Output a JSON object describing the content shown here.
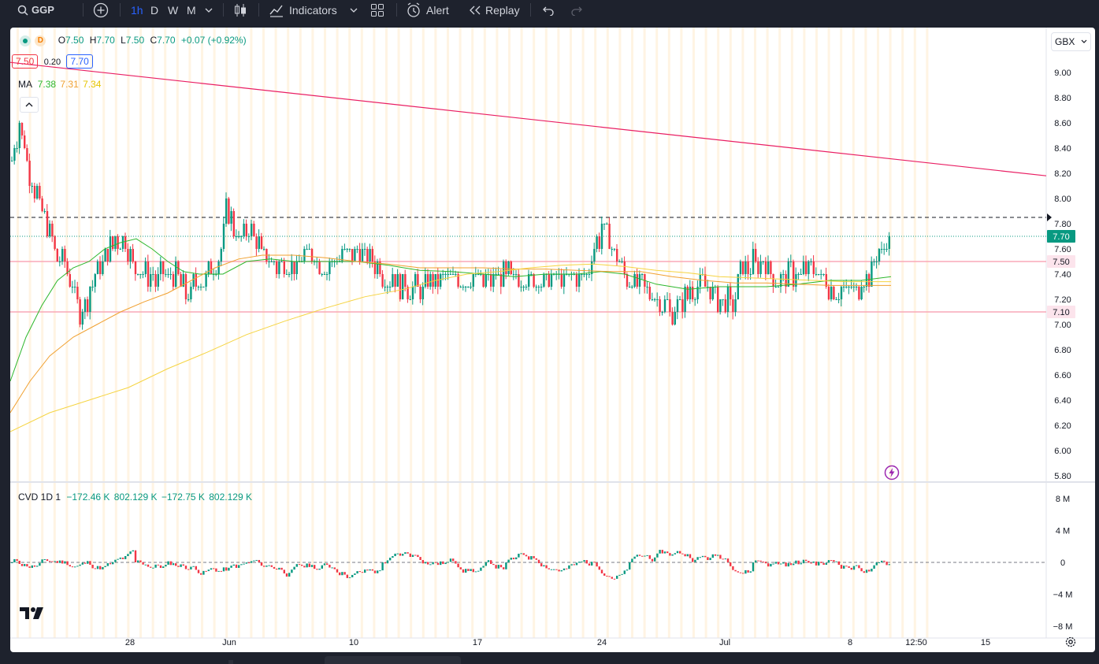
{
  "toolbar": {
    "symbol": "GGP",
    "intervals": [
      "1h",
      "D",
      "W",
      "M"
    ],
    "indicators_label": "Indicators",
    "alert_label": "Alert",
    "replay_label": "Replay"
  },
  "legend": {
    "open_label": "O",
    "open": "7.50",
    "high_label": "H",
    "high": "7.70",
    "low_label": "L",
    "low": "7.50",
    "close_label": "C",
    "close": "7.70",
    "change": "+0.07 (+0.92%)",
    "bid": "7.50",
    "spread": "0.20",
    "ask": "7.70",
    "ma_label": "MA",
    "ma_values": [
      "7.38",
      "7.31",
      "7.34"
    ],
    "cvd_label": "CVD 1D 1",
    "cvd_values": [
      "−172.46 K",
      "802.129 K",
      "−172.75 K",
      "802.129 K"
    ],
    "currency": "GBX"
  },
  "price_scale": [
    "9.00",
    "8.80",
    "8.60",
    "8.40",
    "8.20",
    "8.00",
    "7.80",
    "7.60",
    "7.40",
    "7.20",
    "7.00",
    "6.80",
    "6.60",
    "6.40",
    "6.20",
    "6.00",
    "5.80"
  ],
  "price_badges": {
    "last": "7.70",
    "upper_line": "7.50",
    "lower_line": "7.10"
  },
  "cvd_scale": [
    "8 M",
    "4 M",
    "0",
    "−4 M",
    "−8 M"
  ],
  "time_labels": [
    "28",
    "Jun",
    "10",
    "17",
    "24",
    "Jul",
    "8",
    "12:50",
    "15"
  ],
  "colors": {
    "up": "#089981",
    "down": "#f23645",
    "ma_fast": "#2db72d",
    "ma_mid": "#f0a030",
    "ma_slow": "#f5d442",
    "trendline": "#e91e63",
    "hline": "#f8a8b8"
  },
  "icons": [
    "search-icon",
    "add-symbol-icon",
    "chevron-down-icon",
    "candles-icon",
    "indicators-icon",
    "layout-icon",
    "alert-icon",
    "replay-icon",
    "undo-icon",
    "redo-icon",
    "tradingview-logo",
    "settings-icon",
    "lightning-icon"
  ],
  "chart_data": {
    "type": "candlestick",
    "x_range": [
      "May 24",
      "Jul 10"
    ],
    "ylim": [
      5.8,
      9.1
    ],
    "last_price": 7.7,
    "horizontal_lines": [
      7.85,
      7.5,
      7.1
    ],
    "trendline": {
      "from": 9.08,
      "to": 8.18
    },
    "ma": [
      7.38,
      7.31,
      7.34
    ],
    "cvd_range": [
      -8,
      8
    ]
  }
}
